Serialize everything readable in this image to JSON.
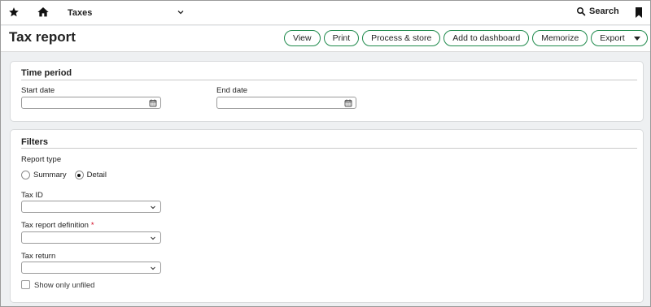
{
  "topbar": {
    "module": "Taxes",
    "search_label": "Search",
    "icons": [
      "star-icon",
      "home-icon",
      "chevron-down-icon",
      "search-icon",
      "bookmark-icon"
    ]
  },
  "header": {
    "title": "Tax report",
    "buttons": {
      "view": "View",
      "print": "Print",
      "process": "Process & store",
      "dashboard": "Add to dashboard",
      "memorize": "Memorize",
      "export": "Export"
    }
  },
  "time_period": {
    "title": "Time period",
    "start_date": {
      "label": "Start date",
      "value": ""
    },
    "end_date": {
      "label": "End date",
      "value": ""
    }
  },
  "filters": {
    "title": "Filters",
    "report_type": {
      "label": "Report type",
      "options": [
        "Summary",
        "Detail"
      ],
      "selected": "Detail"
    },
    "tax_id": {
      "label": "Tax ID",
      "value": ""
    },
    "tax_report_definition": {
      "label": "Tax report definition",
      "required_mark": "*",
      "value": ""
    },
    "tax_return": {
      "label": "Tax return",
      "value": ""
    },
    "show_only_unfiled": {
      "label": "Show only unfiled",
      "checked": false
    }
  },
  "colors": {
    "accent_green": "#1f8a4c",
    "required_red": "#d0021b",
    "page_bg": "#eef0f2"
  }
}
